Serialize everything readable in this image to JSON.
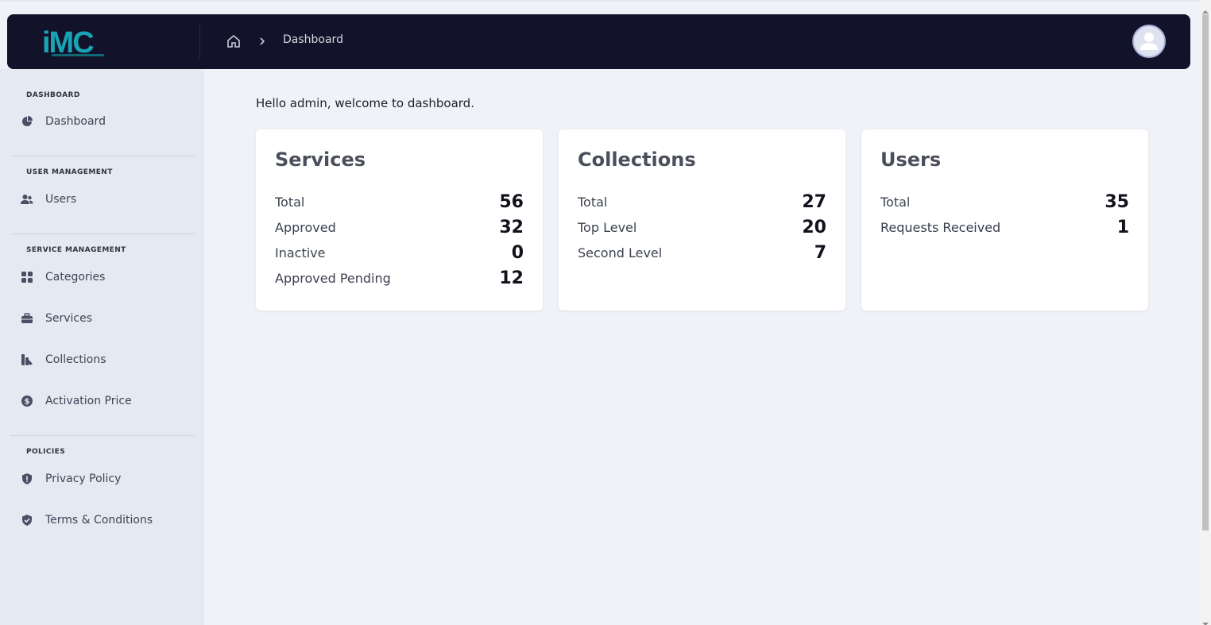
{
  "brand": {
    "logo_text": "iMC",
    "accent": "#1aa3b2",
    "header_bg": "#13122b"
  },
  "breadcrumb": {
    "home_icon": "home-icon",
    "current": "Dashboard"
  },
  "sidebar": {
    "sections": [
      {
        "title": "DASHBOARD",
        "items": [
          {
            "label": "Dashboard",
            "icon": "pie-chart-icon"
          }
        ]
      },
      {
        "title": "USER MANAGEMENT",
        "items": [
          {
            "label": "Users",
            "icon": "users-icon"
          }
        ]
      },
      {
        "title": "SERVICE MANAGEMENT",
        "items": [
          {
            "label": "Categories",
            "icon": "grid-icon"
          },
          {
            "label": "Services",
            "icon": "briefcase-icon"
          },
          {
            "label": "Collections",
            "icon": "collections-icon"
          },
          {
            "label": "Activation Price",
            "icon": "dollar-icon"
          }
        ]
      },
      {
        "title": "POLICIES",
        "items": [
          {
            "label": "Privacy Policy",
            "icon": "shield-icon"
          },
          {
            "label": "Terms & Conditions",
            "icon": "shield-check-icon"
          }
        ]
      }
    ]
  },
  "main": {
    "welcome": "Hello admin, welcome to dashboard.",
    "cards": [
      {
        "title": "Services",
        "stats": [
          {
            "label": "Total",
            "value": "56"
          },
          {
            "label": "Approved",
            "value": "32"
          },
          {
            "label": "Inactive",
            "value": "0"
          },
          {
            "label": "Approved Pending",
            "value": "12"
          }
        ]
      },
      {
        "title": "Collections",
        "stats": [
          {
            "label": "Total",
            "value": "27"
          },
          {
            "label": "Top Level",
            "value": "20"
          },
          {
            "label": "Second Level",
            "value": "7"
          }
        ]
      },
      {
        "title": "Users",
        "stats": [
          {
            "label": "Total",
            "value": "35"
          },
          {
            "label": "Requests Received",
            "value": "1"
          }
        ]
      }
    ]
  }
}
